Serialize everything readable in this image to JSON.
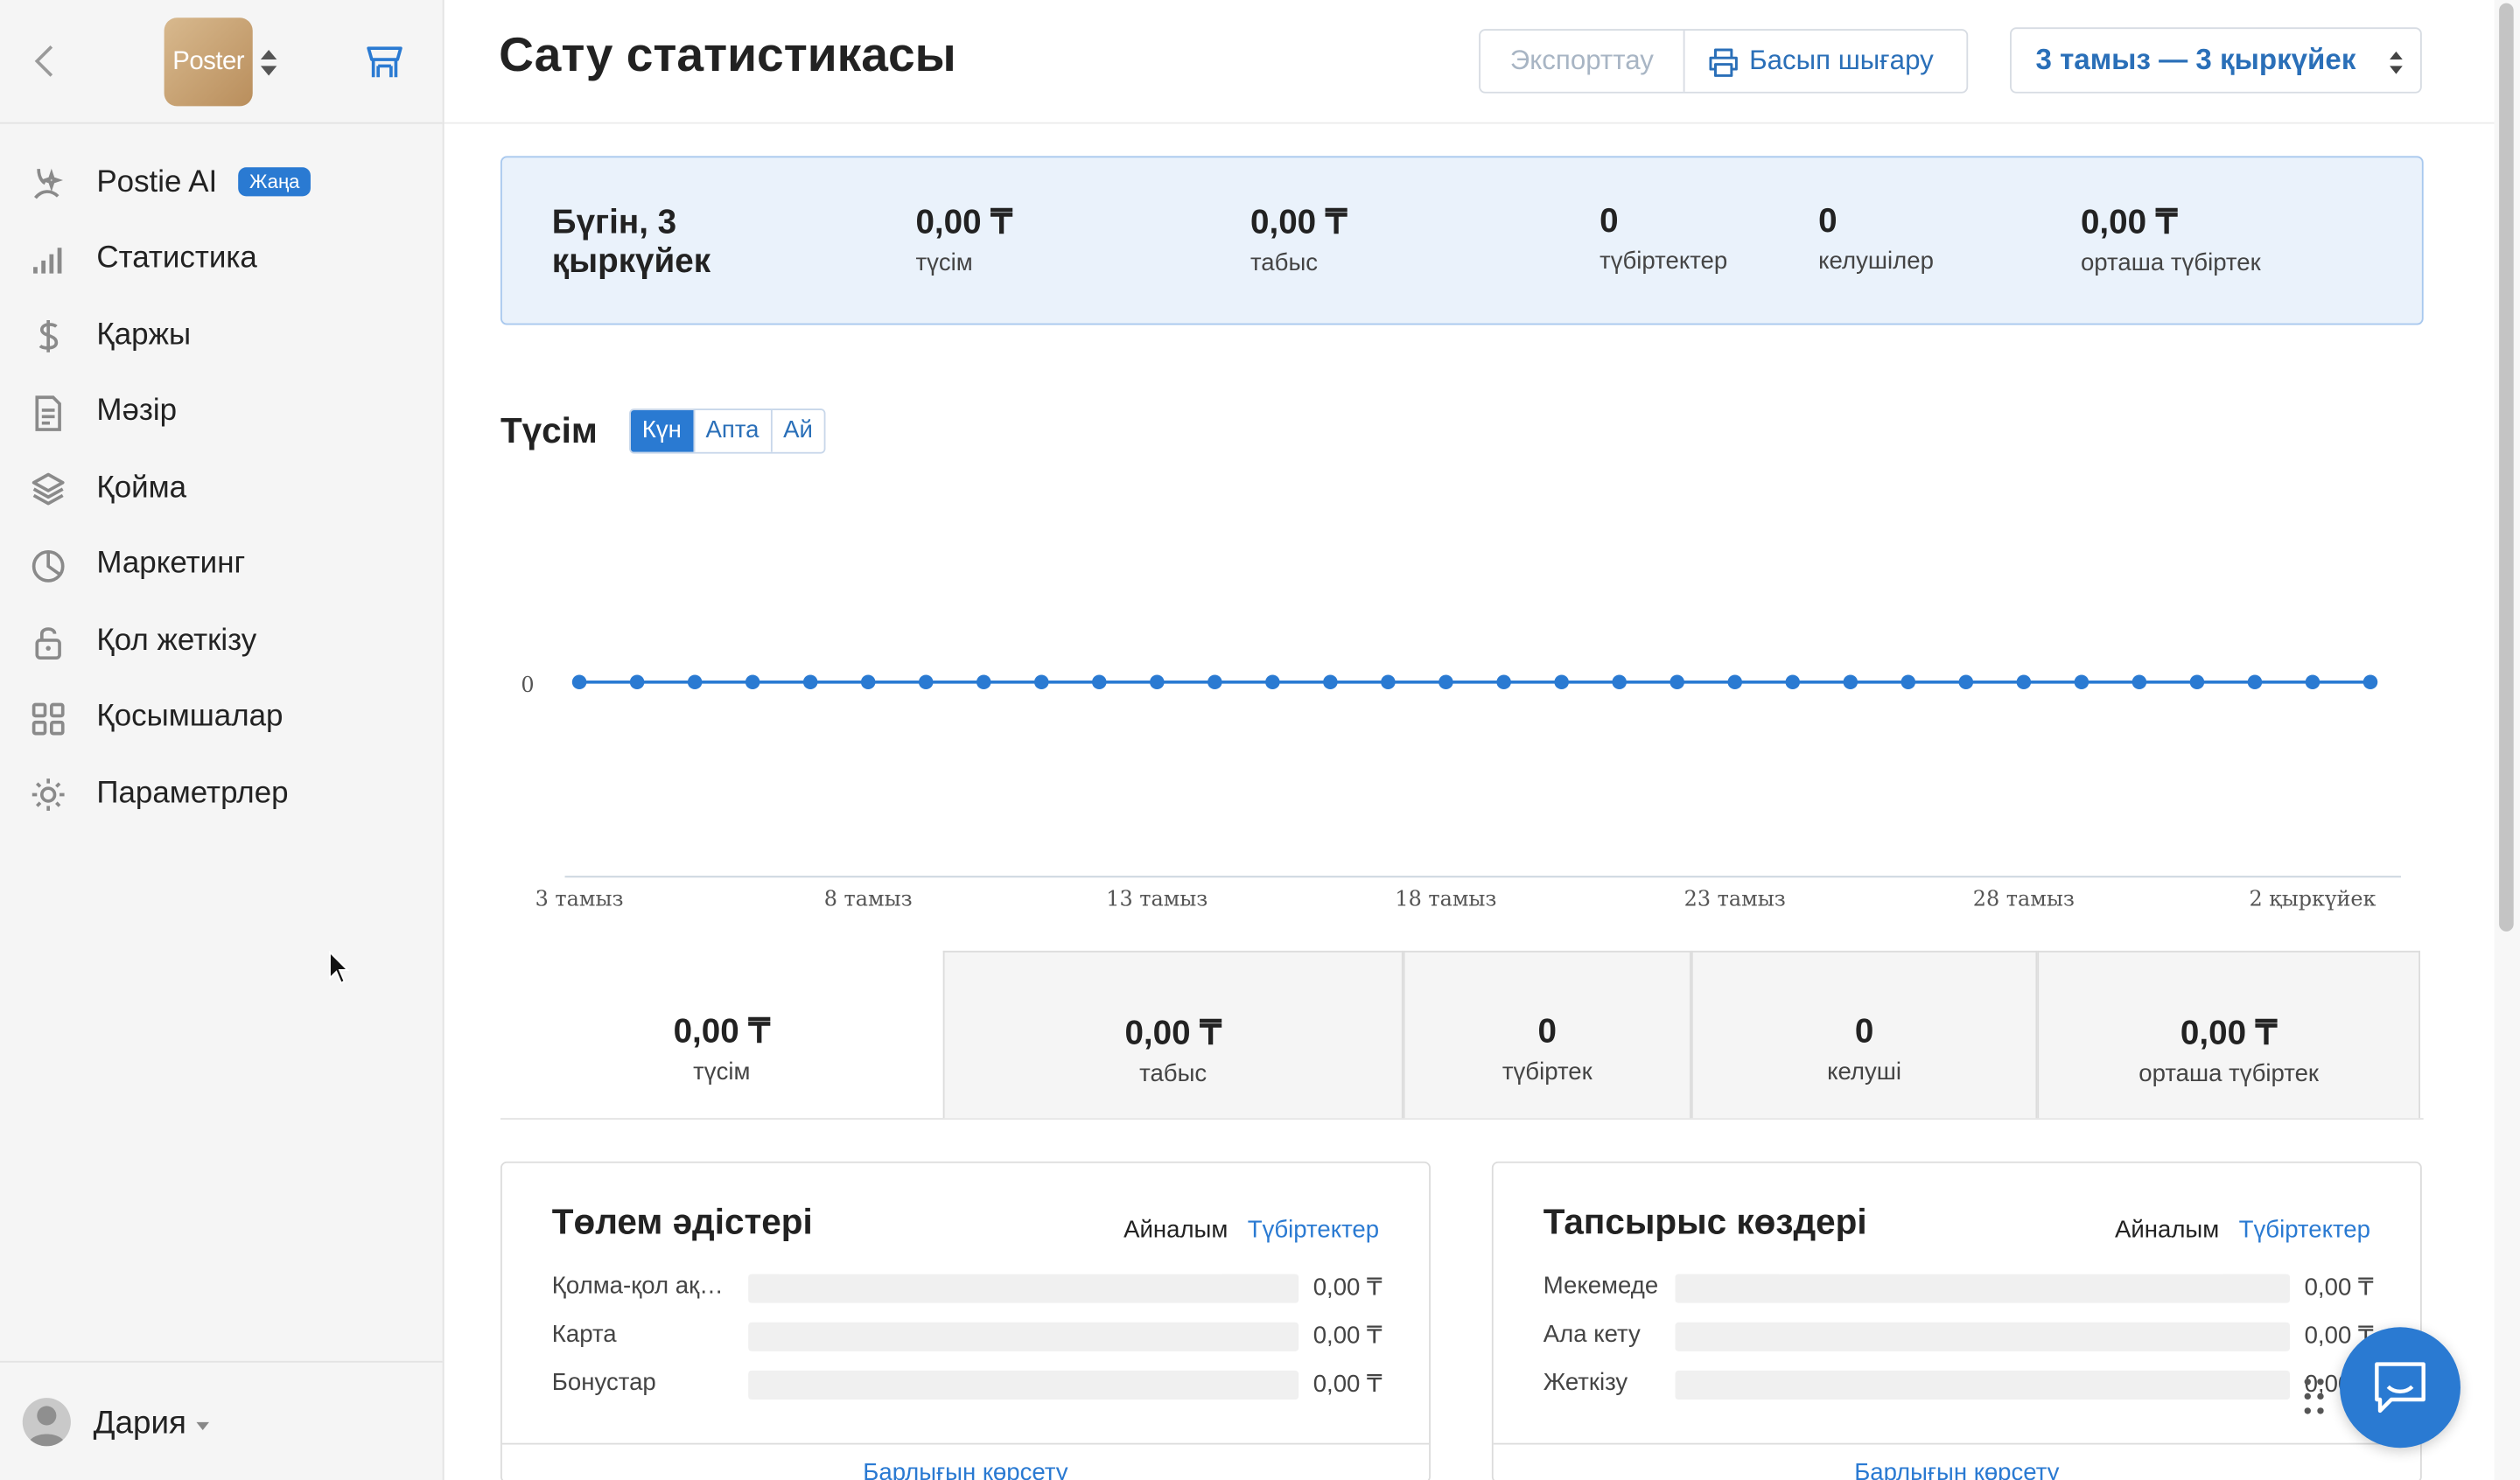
{
  "sidebar": {
    "logo_text": "Poster",
    "items": [
      {
        "label": "Postie AI",
        "icon": "ai-sparkle-icon",
        "badge": "Жаңа"
      },
      {
        "label": "Статистика",
        "icon": "bar-chart-icon"
      },
      {
        "label": "Қаржы",
        "icon": "dollar-icon"
      },
      {
        "label": "Мәзір",
        "icon": "document-icon"
      },
      {
        "label": "Қойма",
        "icon": "layers-icon"
      },
      {
        "label": "Маркетинг",
        "icon": "pie-chart-icon"
      },
      {
        "label": "Қол жеткізу",
        "icon": "lock-icon"
      },
      {
        "label": "Қосымшалар",
        "icon": "grid-icon"
      },
      {
        "label": "Параметрлер",
        "icon": "gear-icon"
      }
    ],
    "user_name": "Дария"
  },
  "header": {
    "title": "Сату статистикасы",
    "export_label": "Экспорттау",
    "print_label": "Басып шығару",
    "date_range": "3 тамыз — 3 қыркүйек"
  },
  "today": {
    "title": "Бүгін, 3 қыркүйек",
    "stats": [
      {
        "value": "0,00 ₸",
        "label": "түсім"
      },
      {
        "value": "0,00 ₸",
        "label": "табыс"
      },
      {
        "value": "0",
        "label": "түбіртектер"
      },
      {
        "value": "0",
        "label": "келушілер"
      },
      {
        "value": "0,00 ₸",
        "label": "орташа түбіртек"
      }
    ]
  },
  "revenue_chart": {
    "title": "Түсім",
    "periods": [
      "Күн",
      "Апта",
      "Ай"
    ],
    "active_period": "Күн"
  },
  "chart_data": {
    "type": "line",
    "title": "Түсім",
    "xlabel": "",
    "ylabel": "",
    "x": [
      "3 тамыз",
      "4 тамыз",
      "5 тамыз",
      "6 тамыз",
      "7 тамыз",
      "8 тамыз",
      "9 тамыз",
      "10 тамыз",
      "11 тамыз",
      "12 тамыз",
      "13 тамыз",
      "14 тамыз",
      "15 тамыз",
      "16 тамыз",
      "17 тамыз",
      "18 тамыз",
      "19 тамыз",
      "20 тамыз",
      "21 тамыз",
      "22 тамыз",
      "23 тамыз",
      "24 тамыз",
      "25 тамыз",
      "26 тамыз",
      "27 тамыз",
      "28 тамыз",
      "29 тамыз",
      "30 тамыз",
      "31 тамыз",
      "1 қыркүйек",
      "2 қыркүйек",
      "3 қыркүйек"
    ],
    "series": [
      {
        "values": [
          0,
          0,
          0,
          0,
          0,
          0,
          0,
          0,
          0,
          0,
          0,
          0,
          0,
          0,
          0,
          0,
          0,
          0,
          0,
          0,
          0,
          0,
          0,
          0,
          0,
          0,
          0,
          0,
          0,
          0,
          0,
          0
        ]
      }
    ],
    "x_tick_labels": [
      "3 тамыз",
      "8 тамыз",
      "13 тамыз",
      "18 тамыз",
      "23 тамыз",
      "28 тамыз",
      "2 қыркүйек"
    ],
    "y_tick_labels": [
      "0"
    ],
    "color": "#2a7ad2",
    "grid": false
  },
  "totals": [
    {
      "value": "0,00 ₸",
      "label": "түсім"
    },
    {
      "value": "0,00 ₸",
      "label": "табыс"
    },
    {
      "value": "0",
      "label": "түбіртек"
    },
    {
      "value": "0",
      "label": "келуші"
    },
    {
      "value": "0,00 ₸",
      "label": "орташа түбіртек"
    }
  ],
  "payments": {
    "title": "Төлем әдістері",
    "toggle_turnover": "Айналым",
    "toggle_receipts": "Түбіртектер",
    "rows": [
      {
        "label": "Қолма-қол ақ…",
        "value": "0,00 ₸"
      },
      {
        "label": "Карта",
        "value": "0,00 ₸"
      },
      {
        "label": "Бонустар",
        "value": "0,00 ₸"
      }
    ],
    "show_all": "Барлығын көрсету"
  },
  "sources": {
    "title": "Тапсырыс көздері",
    "toggle_turnover": "Айналым",
    "toggle_receipts": "Түбіртектер",
    "rows": [
      {
        "label": "Мекемеде",
        "value": "0,00 ₸"
      },
      {
        "label": "Ала кету",
        "value": "0,00 ₸"
      },
      {
        "label": "Жеткізу",
        "value": "0,00 ₸"
      }
    ],
    "show_all": "Барлығын көрсету"
  },
  "colors": {
    "accent": "#2a7ad2",
    "sidebar_bg": "#f5f5f5",
    "today_bg": "#eaf2fb"
  }
}
